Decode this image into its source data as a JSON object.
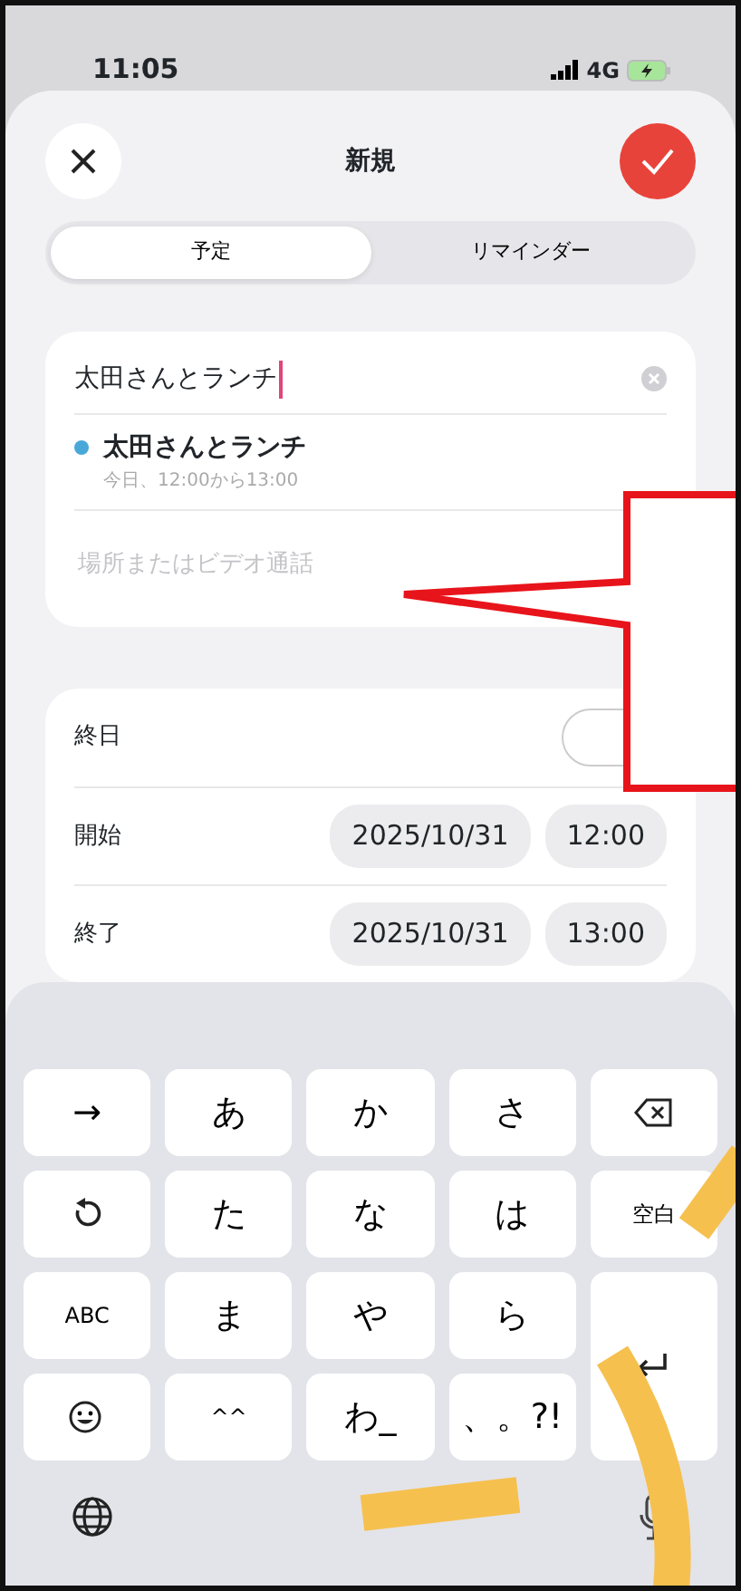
{
  "status_bar": {
    "time": "11:05",
    "network": "4G",
    "charging": true
  },
  "header": {
    "title": "新規"
  },
  "tabs": [
    {
      "label": "予定",
      "selected": true
    },
    {
      "label": "リマインダー",
      "selected": false
    }
  ],
  "event": {
    "title_value": "太田さんとランチ",
    "suggestion": {
      "title": "太田さんとランチ",
      "subtitle": "今日、12:00から13:00",
      "color": "#4aa8d8"
    },
    "location_placeholder": "場所またはビデオ通話"
  },
  "all_day": {
    "label": "終日",
    "on": false
  },
  "times": [
    {
      "label": "開始",
      "date": "2025/10/31",
      "time": "12:00"
    },
    {
      "label": "終了",
      "date": "2025/10/31",
      "time": "13:00"
    }
  ],
  "keyboard": {
    "keys": [
      {
        "kind": "char",
        "label": "→"
      },
      {
        "kind": "char",
        "label": "あ"
      },
      {
        "kind": "char",
        "label": "か"
      },
      {
        "kind": "char",
        "label": "さ"
      },
      {
        "kind": "backspace"
      },
      {
        "kind": "undo"
      },
      {
        "kind": "char",
        "label": "た"
      },
      {
        "kind": "char",
        "label": "な"
      },
      {
        "kind": "char",
        "label": "は"
      },
      {
        "kind": "small",
        "label": "空白"
      },
      {
        "kind": "small",
        "label": "ABC"
      },
      {
        "kind": "char",
        "label": "ま"
      },
      {
        "kind": "char",
        "label": "や"
      },
      {
        "kind": "char",
        "label": "ら"
      },
      {
        "kind": "return"
      },
      {
        "kind": "emoji"
      },
      {
        "kind": "small",
        "label": "^^"
      },
      {
        "kind": "char",
        "label": "わ_"
      },
      {
        "kind": "char",
        "label": "、。?!"
      }
    ]
  }
}
